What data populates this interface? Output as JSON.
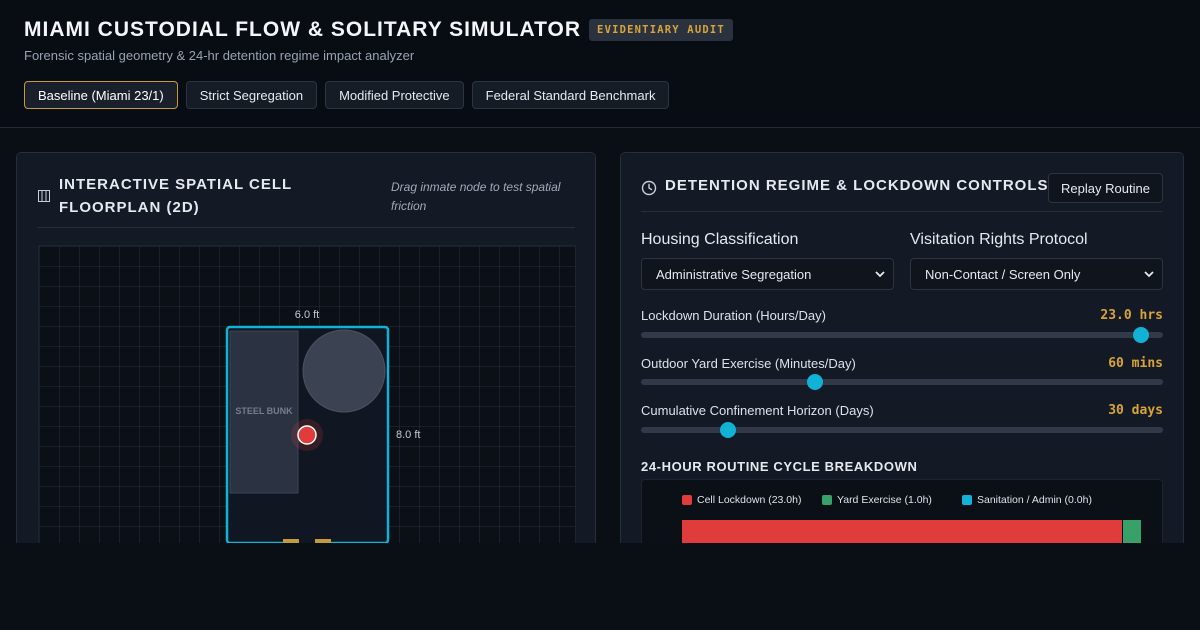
{
  "header": {
    "title": "MIAMI CUSTODIAL FLOW & SOLITARY SIMULATOR",
    "badge": "EVIDENTIARY AUDIT",
    "subtitle": "Forensic spatial geometry & 24-hr detention regime impact analyzer",
    "tabs": [
      {
        "label": "Baseline (Miami 23/1)",
        "active": true
      },
      {
        "label": "Strict Segregation",
        "active": false
      },
      {
        "label": "Modified Protective",
        "active": false
      },
      {
        "label": "Federal Standard Benchmark",
        "active": false
      }
    ]
  },
  "floorplan": {
    "title": "INTERACTIVE SPATIAL CELL FLOORPLAN (2D)",
    "hint": "Drag inmate node to test spatial friction",
    "width_label": "6.0 ft",
    "length_label": "8.0 ft",
    "bunk_label": "STEEL BUNK",
    "colors": {
      "wall": "#12b1d6",
      "inmate": "#e03c3c",
      "door": "#c49a3a"
    }
  },
  "controls": {
    "title": "DETENTION REGIME & LOCKDOWN CONTROLS",
    "replay_label": "Replay Routine",
    "housing": {
      "label": "Housing Classification",
      "value": "Administrative Segregation"
    },
    "visitation": {
      "label": "Visitation Rights Protocol",
      "value": "Non-Contact / Screen Only"
    },
    "sliders": [
      {
        "label": "Lockdown Duration (Hours/Day)",
        "display": "23.0 hrs",
        "value": 23.0,
        "min": 0,
        "max": 24
      },
      {
        "label": "Outdoor Yard Exercise (Minutes/Day)",
        "display": "60 mins",
        "value": 60,
        "min": 0,
        "max": 180
      },
      {
        "label": "Cumulative Confinement Horizon (Days)",
        "display": "30 days",
        "value": 30,
        "min": 0,
        "max": 180
      }
    ]
  },
  "routine": {
    "title": "24-HOUR ROUTINE CYCLE BREAKDOWN",
    "legend": [
      {
        "label": "Cell Lockdown (23.0h)",
        "color": "#e03c3c"
      },
      {
        "label": "Yard Exercise (1.0h)",
        "color": "#38a169"
      },
      {
        "label": "Sanitation / Admin (0.0h)",
        "color": "#12b1d6"
      }
    ],
    "hours": [
      23.0,
      1.0,
      0.0
    ],
    "total_hours": 24
  }
}
